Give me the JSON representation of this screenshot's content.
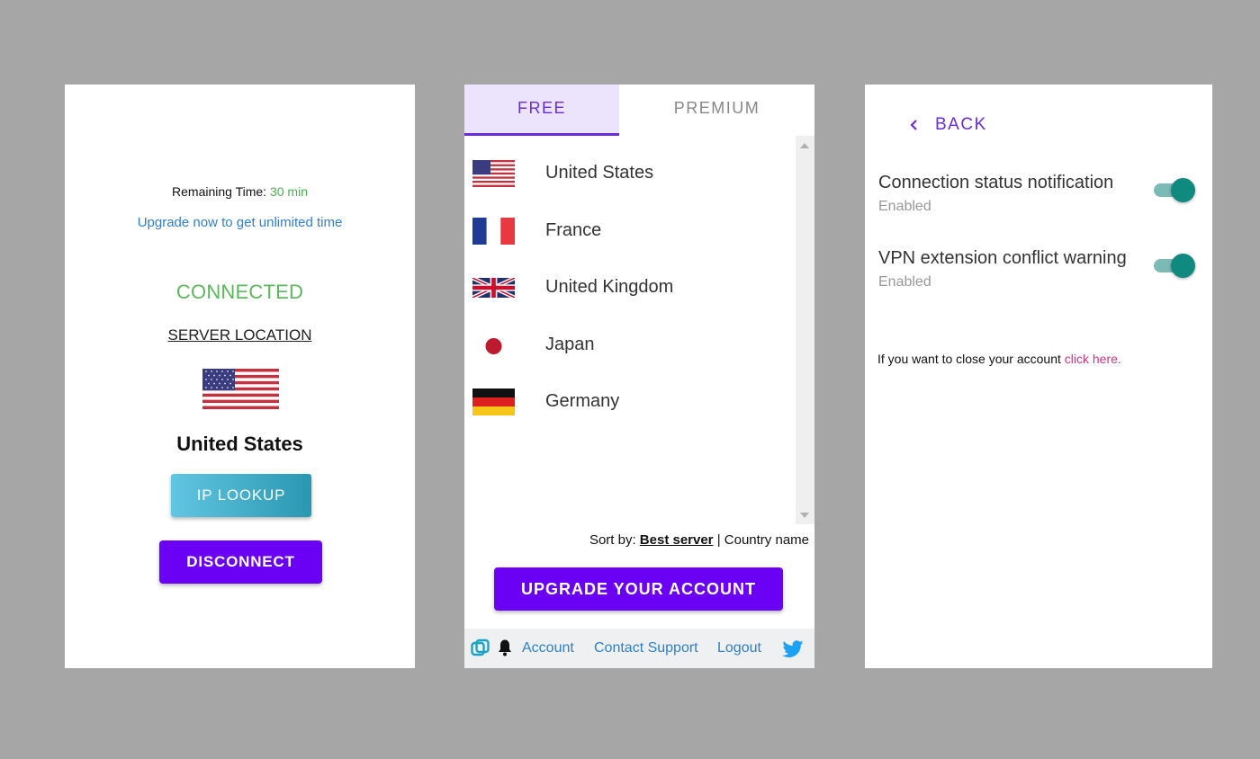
{
  "status_panel": {
    "remaining_label": "Remaining Time:",
    "remaining_value": "30 min",
    "upgrade_link": "Upgrade now to get unlimited time",
    "status": "CONNECTED",
    "server_location_label": "SERVER LOCATION",
    "country": "United States",
    "ip_lookup_button": "IP LOOKUP",
    "disconnect_button": "DISCONNECT",
    "colors": {
      "status": "#5cb85c",
      "link": "#2f80d1",
      "primary": "#6a00f4"
    }
  },
  "server_panel": {
    "tabs": [
      {
        "label": "FREE",
        "active": true
      },
      {
        "label": "PREMIUM",
        "active": false
      }
    ],
    "countries": [
      {
        "name": "United States",
        "flag": "us-flag-icon"
      },
      {
        "name": "France",
        "flag": "fr-flag-icon"
      },
      {
        "name": "United Kingdom",
        "flag": "uk-flag-icon"
      },
      {
        "name": "Japan",
        "flag": "jp-flag-icon"
      },
      {
        "name": "Germany",
        "flag": "de-flag-icon"
      }
    ],
    "sort": {
      "label": "Sort by:",
      "active_option": "Best server",
      "separator": "|",
      "other_option": "Country name"
    },
    "upgrade_button": "UPGRADE YOUR ACCOUNT",
    "footer": {
      "account": "Account",
      "contact_support": "Contact Support",
      "logout": "Logout"
    }
  },
  "settings_panel": {
    "back_label": "BACK",
    "settings": [
      {
        "title": "Connection status notification",
        "status": "Enabled",
        "enabled": true
      },
      {
        "title": "VPN extension conflict warning",
        "status": "Enabled",
        "enabled": true
      }
    ],
    "close_account_text": "If you want to close your account",
    "close_account_link": "click here."
  }
}
